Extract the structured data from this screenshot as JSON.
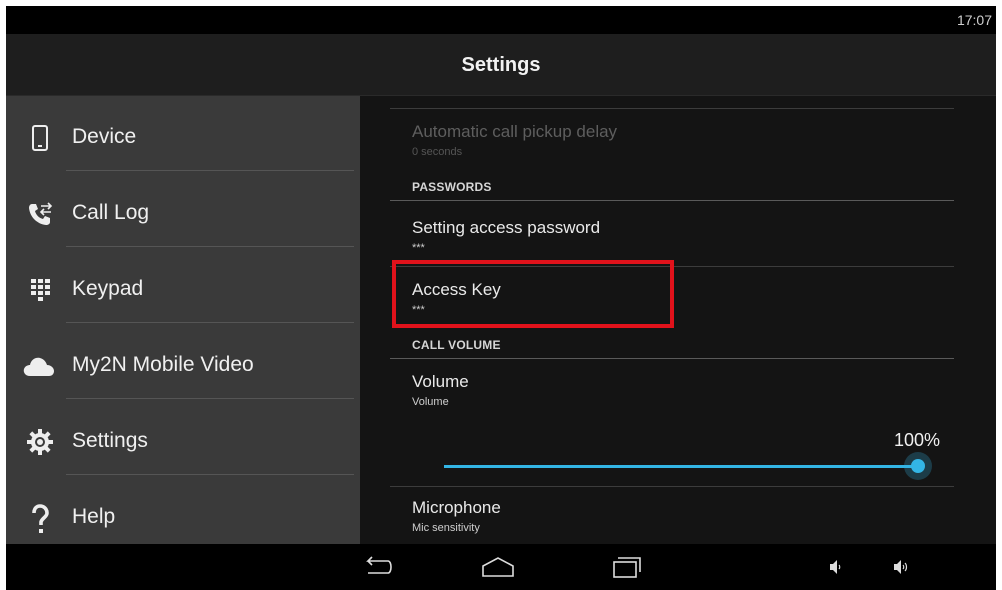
{
  "status_bar": {
    "time": "17:07"
  },
  "action_bar": {
    "title": "Settings"
  },
  "sidebar": {
    "items": [
      {
        "label": "Device",
        "icon": "smartphone-icon"
      },
      {
        "label": "Call Log",
        "icon": "call-log-icon"
      },
      {
        "label": "Keypad",
        "icon": "keypad-icon"
      },
      {
        "label": "My2N Mobile Video",
        "icon": "cloud-icon"
      },
      {
        "label": "Settings",
        "icon": "gear-icon"
      },
      {
        "label": "Help",
        "icon": "question-mark-icon"
      }
    ]
  },
  "settings": {
    "auto_pickup": {
      "title": "Automatic call pickup delay",
      "summary": "0 seconds"
    },
    "passwords_header": "PASSWORDS",
    "access_password": {
      "title": "Setting access password",
      "summary": "***"
    },
    "access_key": {
      "title": "Access Key",
      "summary": "***"
    },
    "call_volume_header": "CALL VOLUME",
    "volume": {
      "title": "Volume",
      "summary": "Volume",
      "value_label": "100%",
      "level": 1.0
    },
    "microphone": {
      "title": "Microphone",
      "summary": "Mic sensitivity"
    }
  },
  "nav_bar": {
    "buttons": [
      "back-icon",
      "home-icon",
      "recent-apps-icon",
      "volume-down-icon",
      "volume-up-icon"
    ]
  },
  "colors": {
    "accent": "#33b5e5",
    "highlight": "#e0121b",
    "sidebar_bg": "#3a3a3a"
  }
}
